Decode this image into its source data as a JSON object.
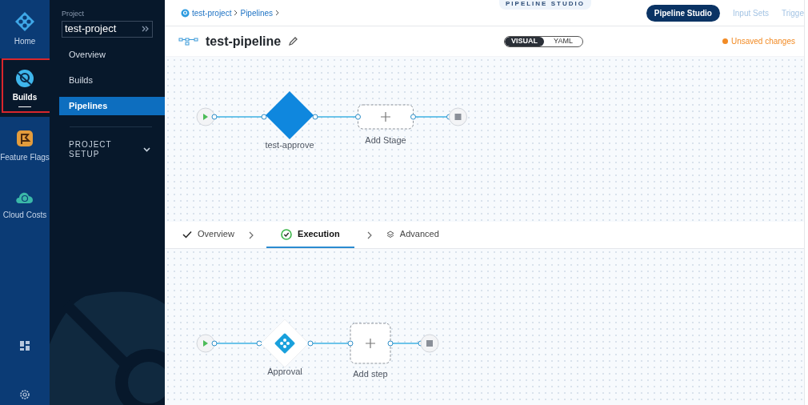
{
  "rail": {
    "items": [
      {
        "label": "Home",
        "selected": false
      },
      {
        "label": "Builds",
        "selected": true
      },
      {
        "label": "Feature Flags",
        "selected": false
      },
      {
        "label": "Cloud Costs",
        "selected": false
      }
    ]
  },
  "nav": {
    "project_label": "Project",
    "project_name": "test-project",
    "items": [
      {
        "label": "Overview",
        "selected": false
      },
      {
        "label": "Builds",
        "selected": false
      },
      {
        "label": "Pipelines",
        "selected": true
      }
    ],
    "section": {
      "label": "PROJECT SETUP",
      "expanded": false
    }
  },
  "header": {
    "breadcrumbs": [
      "test-project",
      "Pipelines"
    ],
    "studio_badge": "PIPELINE STUDIO",
    "tabs": [
      {
        "label": "Pipeline Studio",
        "selected": true
      },
      {
        "label": "Input Sets",
        "selected": false
      },
      {
        "label": "Trigge",
        "selected": false
      }
    ]
  },
  "pipeline": {
    "name": "test-pipeline",
    "view_toggle": [
      {
        "label": "VISUAL",
        "selected": true
      },
      {
        "label": "YAML",
        "selected": false
      }
    ],
    "status": "Unsaved changes"
  },
  "stages": {
    "nodes": [
      {
        "kind": "stage",
        "label": "test-approve"
      },
      {
        "kind": "add",
        "label": "Add Stage"
      }
    ]
  },
  "stage_tabs": [
    {
      "label": "Overview",
      "selected": false
    },
    {
      "label": "Execution",
      "selected": true
    },
    {
      "label": "Advanced",
      "selected": false
    }
  ],
  "steps": {
    "nodes": [
      {
        "kind": "step",
        "label": "Approval"
      },
      {
        "kind": "add",
        "label": "Add step"
      }
    ]
  }
}
